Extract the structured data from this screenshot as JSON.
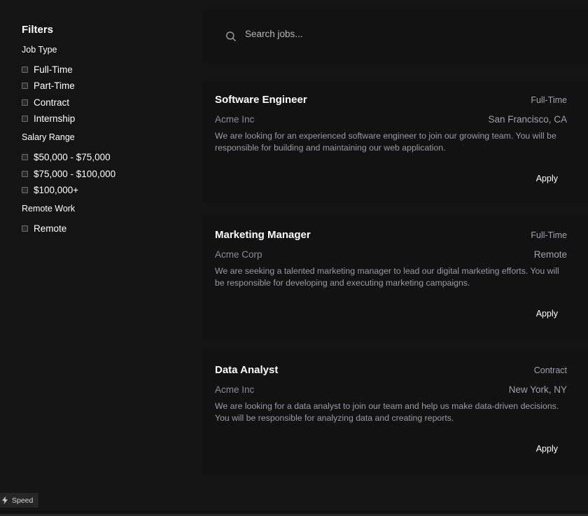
{
  "filters": {
    "title": "Filters",
    "groups": [
      {
        "title": "Job Type",
        "options": [
          "Full-Time",
          "Part-Time",
          "Contract",
          "Internship"
        ]
      },
      {
        "title": "Salary Range",
        "options": [
          "$50,000 - $75,000",
          "$75,000 - $100,000",
          "$100,000+"
        ]
      },
      {
        "title": "Remote Work",
        "options": [
          "Remote"
        ]
      }
    ]
  },
  "search": {
    "placeholder": "Search jobs..."
  },
  "jobs": [
    {
      "title": "Software Engineer",
      "type": "Full-Time",
      "company": "Acme Inc",
      "location": "San Francisco, CA",
      "description": "We are looking for an experienced software engineer to join our growing team. You will be responsible for building and maintaining our web application.",
      "apply_label": "Apply"
    },
    {
      "title": "Marketing Manager",
      "type": "Full-Time",
      "company": "Acme Corp",
      "location": "Remote",
      "description": "We are seeking a talented marketing manager to lead our digital marketing efforts. You will be responsible for developing and executing marketing campaigns.",
      "apply_label": "Apply"
    },
    {
      "title": "Data Analyst",
      "type": "Contract",
      "company": "Acme Inc",
      "location": "New York, NY",
      "description": "We are looking for a data analyst to join our team and help us make data-driven decisions. You will be responsible for analyzing data and creating reports.",
      "apply_label": "Apply"
    }
  ],
  "badge": {
    "label": "Speed",
    "icon": "lightning-icon"
  }
}
